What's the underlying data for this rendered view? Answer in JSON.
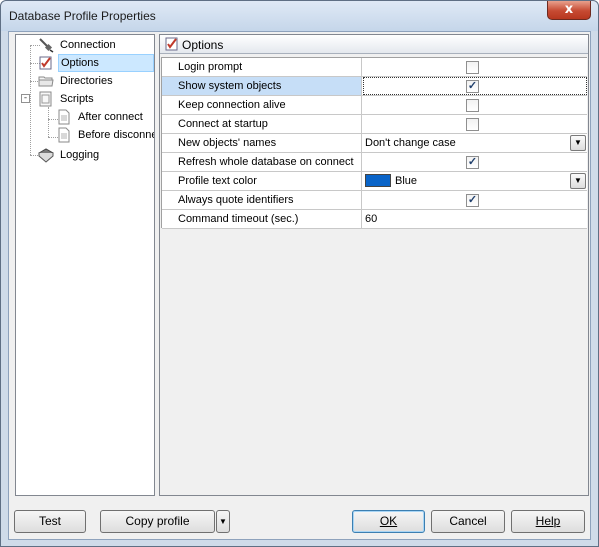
{
  "window": {
    "title": "Database Profile Properties",
    "close_glyph": "x"
  },
  "tree": {
    "items": [
      {
        "label": "Connection",
        "icon": "plug-icon"
      },
      {
        "label": "Options",
        "icon": "options-checklist-icon",
        "selected": true
      },
      {
        "label": "Directories",
        "icon": "folder-icon"
      },
      {
        "label": "Scripts",
        "icon": "script-icon",
        "expander": "-"
      },
      {
        "label": "After connect",
        "icon": "document-icon"
      },
      {
        "label": "Before disconnec",
        "icon": "document-icon"
      },
      {
        "label": "Logging",
        "icon": "book-icon"
      }
    ]
  },
  "panel": {
    "header": "Options"
  },
  "options": [
    {
      "name": "Login prompt",
      "type": "checkbox",
      "checked": false
    },
    {
      "name": "Show system objects",
      "type": "checkbox",
      "checked": true,
      "selected": true
    },
    {
      "name": "Keep connection alive",
      "type": "checkbox",
      "checked": false
    },
    {
      "name": "Connect at startup",
      "type": "checkbox",
      "checked": false
    },
    {
      "name": "New objects' names",
      "type": "dropdown",
      "value": "Don't change case"
    },
    {
      "name": "Refresh whole database on connect",
      "type": "checkbox",
      "checked": true
    },
    {
      "name": "Profile text color",
      "type": "color",
      "value": "Blue",
      "color": "#0a64c8"
    },
    {
      "name": "Always quote identifiers",
      "type": "checkbox",
      "checked": true
    },
    {
      "name": "Command timeout (sec.)",
      "type": "text",
      "value": "60"
    }
  ],
  "check_glyph": "✓",
  "dropdown_glyph": "▼",
  "buttons": {
    "test": "Test",
    "copy_profile": "Copy profile",
    "copy_profile_arrow": "▼",
    "ok": "OK",
    "cancel": "Cancel",
    "help": "Help"
  },
  "colors": {
    "selection": "#c6def7",
    "tree_selection": "#cce8ff"
  }
}
